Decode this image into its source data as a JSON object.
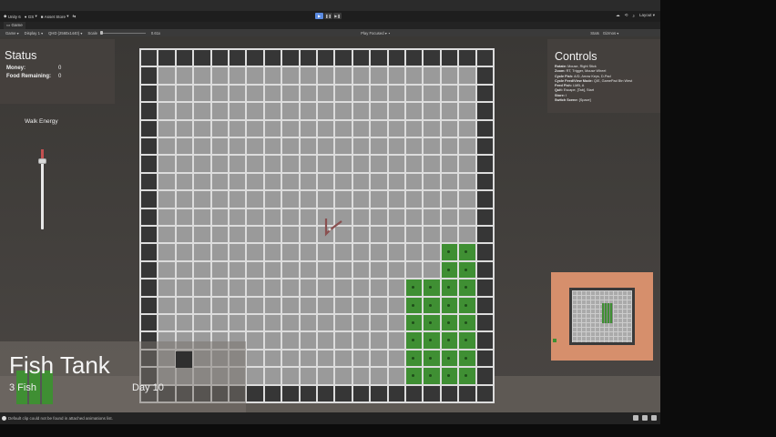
{
  "toolbar": {
    "app": "Unity 6",
    "account": "GS",
    "store": "Asset Store",
    "play": "▶",
    "pause": "❚❚",
    "step": "▶❚",
    "layout": "Layout"
  },
  "tabbar": {
    "tab": "Game"
  },
  "gamebar": {
    "view": "Game",
    "display": "Display 1",
    "resolution": "QHD (2560x1440)",
    "scale_label": "Scale",
    "scale_value": "0.61x",
    "play_focused": "Play Focused",
    "stats": "Stats",
    "gizmos": "Gizmos"
  },
  "status": {
    "title": "Status",
    "money_label": "Money:",
    "money_value": "0",
    "food_label": "Food Remaining:",
    "food_value": "0"
  },
  "walk_energy": {
    "label": "Walk Energy",
    "level": 0.85
  },
  "controls": {
    "title": "Controls",
    "rows": [
      {
        "k": "Rotate:",
        "v": "Mouse, Right Stick"
      },
      {
        "k": "Zoom:",
        "v": "RT, Trigger, Mouse Wheel"
      },
      {
        "k": "Cycle Fish:",
        "v": "A/D, Arrow Keys, D-Pad"
      },
      {
        "k": "Cycle Feed/View Mode:",
        "v": "Q/E, GamePad Btn West"
      },
      {
        "k": "Feed Fish:",
        "v": "LMB, A"
      },
      {
        "k": "Quit:",
        "v": "Escape, [Tab], Start"
      },
      {
        "k": "Store:",
        "v": "I"
      },
      {
        "k": "Switch Scene:",
        "v": "[Space]"
      }
    ]
  },
  "hud": {
    "title": "Fish Tank",
    "fish_count": "3 Fish",
    "day": "Day 10"
  },
  "statusbar": {
    "message": "Default clip could not be found in attached animations list."
  },
  "colors": {
    "weed": "#3f8f33",
    "wall": "#363636",
    "water": "#9a9a9a",
    "minimap_bg": "#d68f6c"
  }
}
